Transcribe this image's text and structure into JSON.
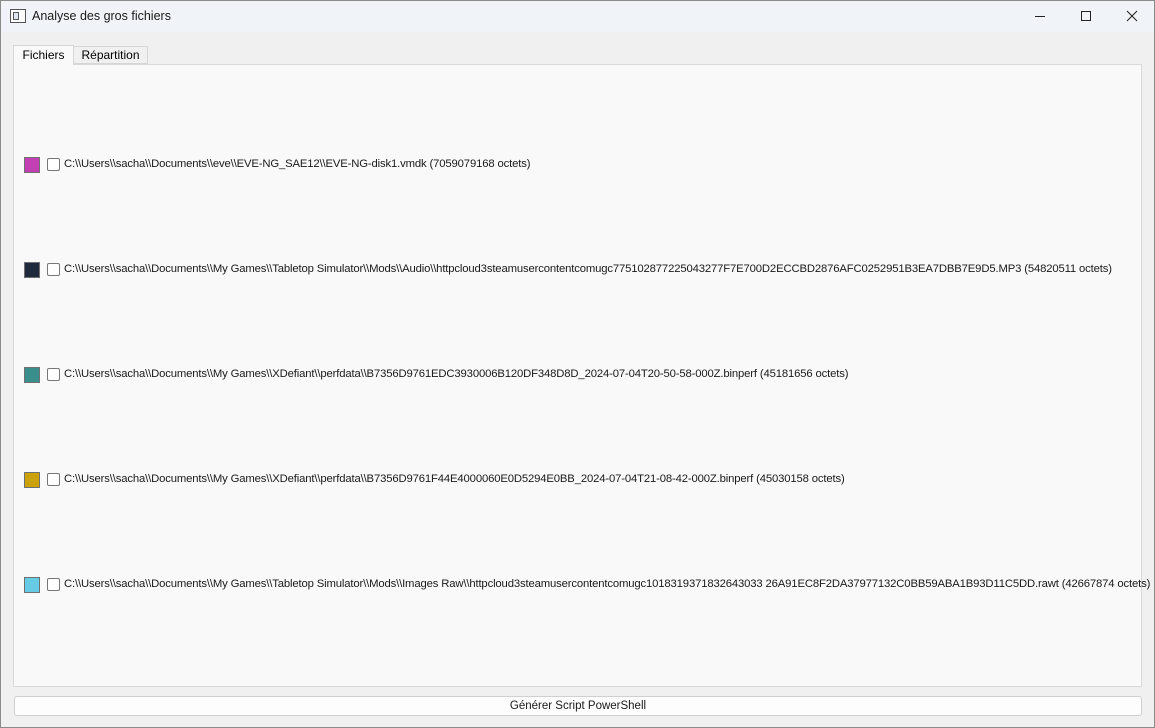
{
  "window": {
    "title": "Analyse des gros fichiers"
  },
  "tabs": [
    {
      "label": "Fichiers",
      "selected": true
    },
    {
      "label": "Répartition",
      "selected": false
    }
  ],
  "files": [
    {
      "color": "#c23fb4",
      "checked": false,
      "label": "C:\\\\Users\\\\sacha\\\\Documents\\\\eve\\\\EVE-NG_SAE12\\\\EVE-NG-disk1.vmdk (7059079168 octets)"
    },
    {
      "color": "#1f2a3c",
      "checked": false,
      "label": "C:\\\\Users\\\\sacha\\\\Documents\\\\My Games\\\\Tabletop Simulator\\\\Mods\\\\Audio\\\\httpcloud3steamusercontentcomugc775102877225043277F7E700D2ECCBD2876AFC0252951B3EA7DBB7E9D5.MP3 (54820511 octets)"
    },
    {
      "color": "#3a8f8c",
      "checked": false,
      "label": "C:\\\\Users\\\\sacha\\\\Documents\\\\My Games\\\\XDefiant\\\\perfdata\\\\B7356D9761EDC3930006B120DF348D8D_2024-07-04T20-50-58-000Z.binperf (45181656 octets)"
    },
    {
      "color": "#c9a20e",
      "checked": false,
      "label": "C:\\\\Users\\\\sacha\\\\Documents\\\\My Games\\\\XDefiant\\\\perfdata\\\\B7356D9761F44E4000060E0D5294E0BB_2024-07-04T21-08-42-000Z.binperf (45030158 octets)"
    },
    {
      "color": "#67cbe6",
      "checked": false,
      "label": "C:\\\\Users\\\\sacha\\\\Documents\\\\My Games\\\\Tabletop Simulator\\\\Mods\\\\Images Raw\\\\httpcloud3steamusercontentcomugc1018319371832643033 26A91EC8F2DA37977132C0BB59ABA1B93D11C5DD.rawt (42667874 octets)"
    }
  ],
  "actions": {
    "generate_label": "Générer Script PowerShell"
  }
}
